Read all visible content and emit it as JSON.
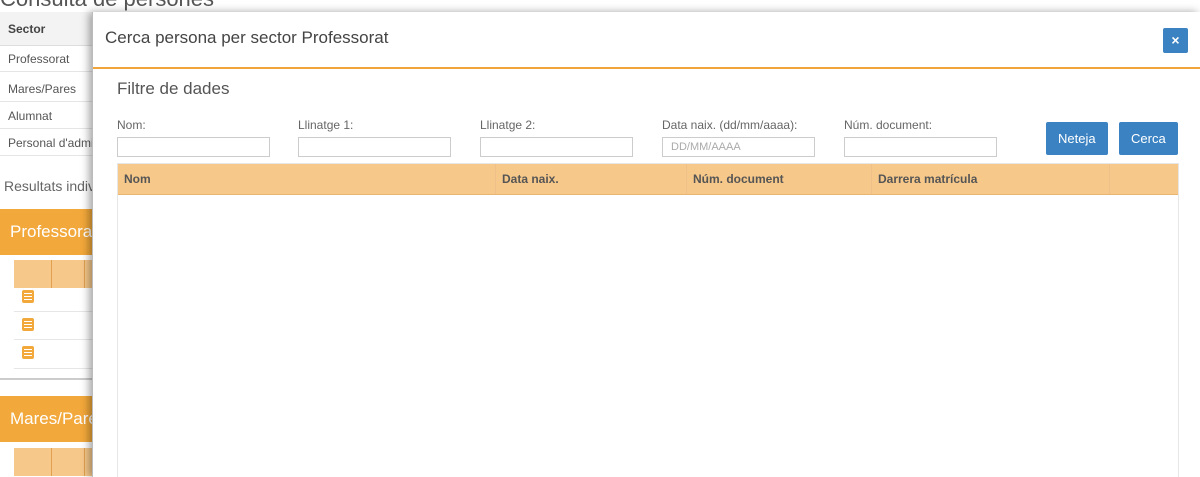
{
  "background": {
    "title": "Consulta de persones",
    "sector_header": "Sector",
    "sector_items": [
      "Professorat",
      "Mares/Pares",
      "Alumnat",
      "Personal d'administració"
    ],
    "results_label": "Resultats individuals",
    "section_professorat": "Professorat",
    "section_mares_pares": "Mares/Pares"
  },
  "modal": {
    "title": "Cerca persona per sector Professorat",
    "close_label": "×",
    "filter_title": "Filtre de dades",
    "fields": {
      "nom": {
        "label": "Nom:",
        "value": "",
        "placeholder": ""
      },
      "llinatge1": {
        "label": "Llinatge 1:",
        "value": "",
        "placeholder": ""
      },
      "llinatge2": {
        "label": "Llinatge 2:",
        "value": "",
        "placeholder": ""
      },
      "data_naix": {
        "label": "Data naix. (dd/mm/aaaa):",
        "value": "",
        "placeholder": "DD/MM/AAAA"
      },
      "num_document": {
        "label": "Núm. document:",
        "value": "",
        "placeholder": ""
      }
    },
    "buttons": {
      "clear": "Neteja",
      "search": "Cerca"
    },
    "table": {
      "columns": [
        "Nom",
        "Data naix.",
        "Núm. document",
        "Darrera matrícula",
        ""
      ],
      "rows": []
    }
  },
  "colors": {
    "accent": "#f2a83a",
    "table_header": "#f6c88a",
    "button": "#3a82c2"
  }
}
